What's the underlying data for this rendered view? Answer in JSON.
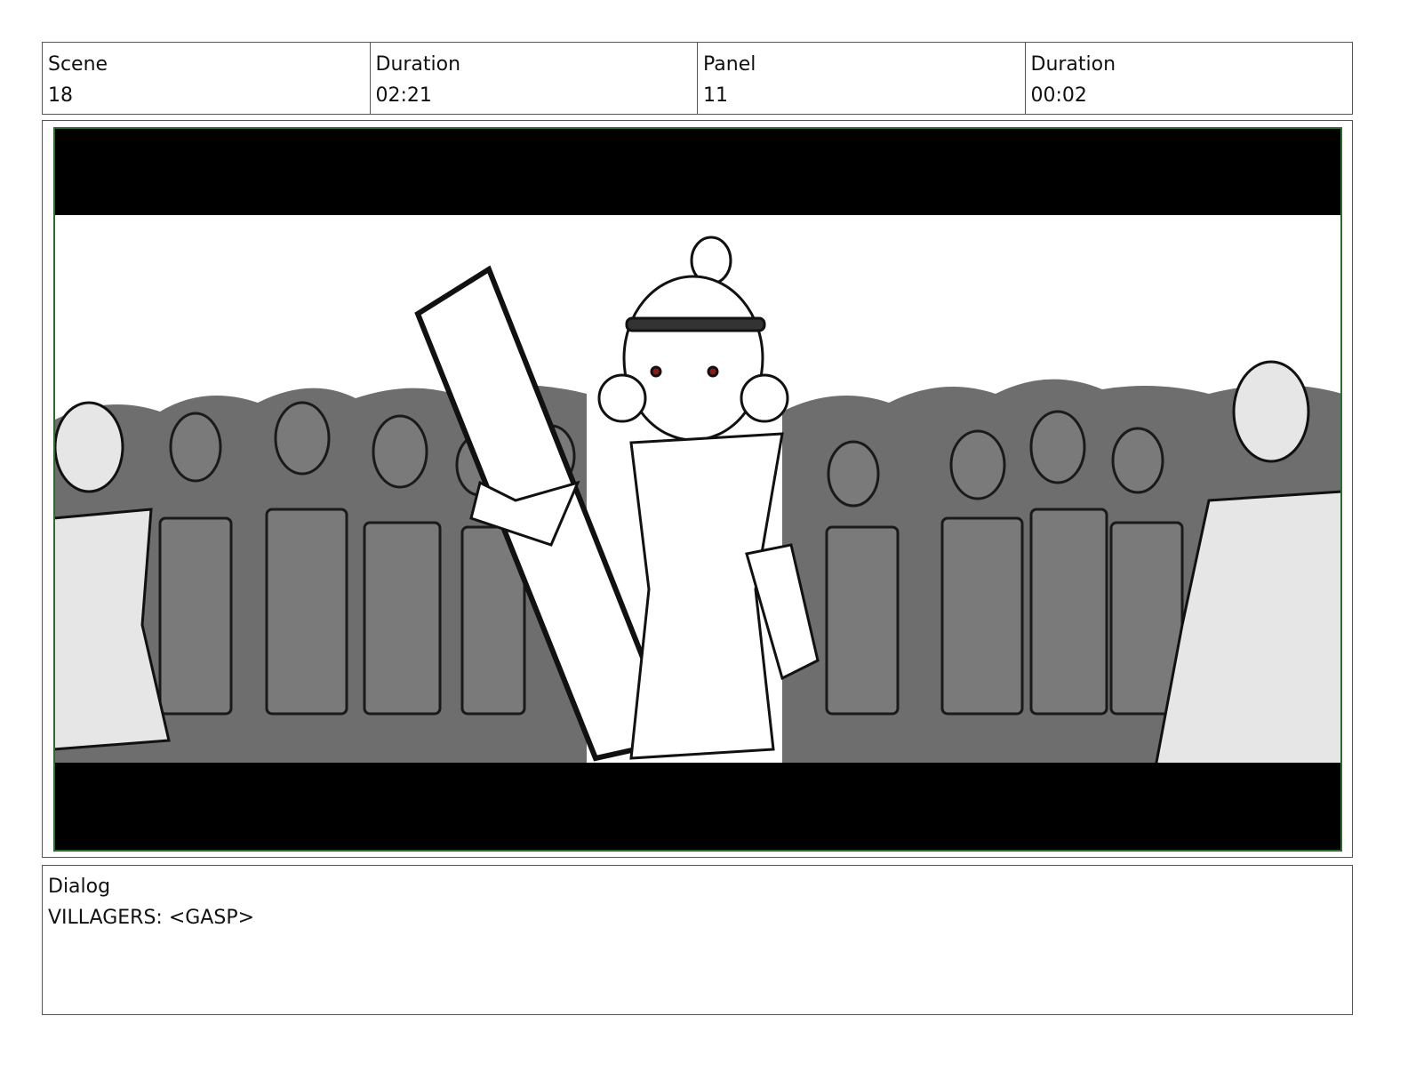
{
  "header": {
    "scene_label": "Scene",
    "scene_value": "18",
    "scene_duration_label": "Duration",
    "scene_duration_value": "02:21",
    "panel_label": "Panel",
    "panel_value": "11",
    "panel_duration_label": "Duration",
    "panel_duration_value": "00:02"
  },
  "dialog": {
    "label": "Dialog",
    "text": "VILLAGERS: <GASP>"
  },
  "colors": {
    "frame_border": "#2e6b2e",
    "letterbox": "#000000",
    "crowd_gray": "#6e6e6e"
  }
}
